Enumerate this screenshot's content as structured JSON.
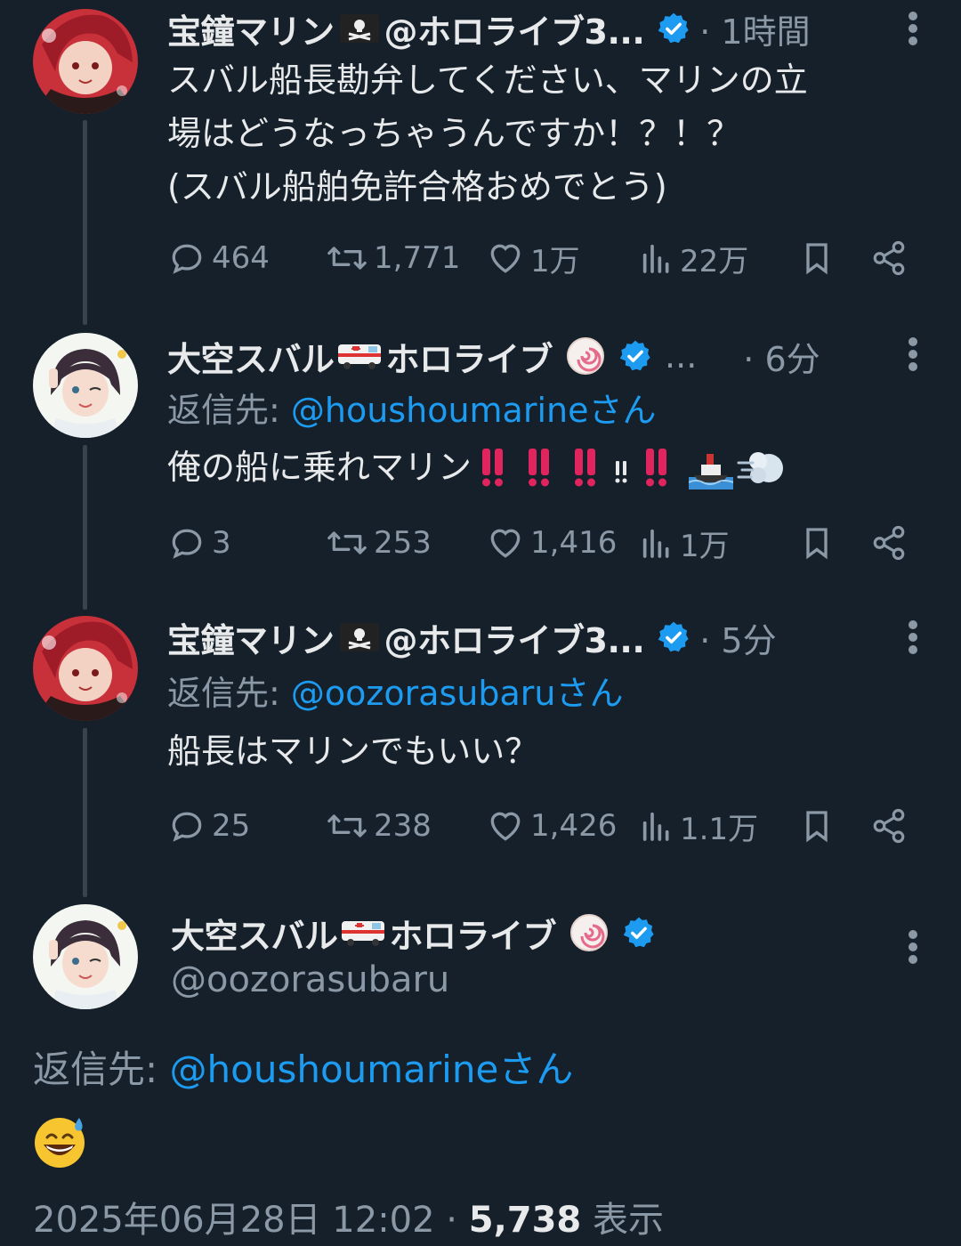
{
  "tweets": [
    {
      "name": "宝鐘マリン",
      "name_suffix": "@ホロライブ3...",
      "name_emoji": "pirate-flag-icon",
      "time": "· 1時間",
      "reply_to_label": "",
      "reply_to_handle": "",
      "text_lines": [
        "スバル船長勘弁してください、マリンの立",
        "場はどうなっちゃうんですか！？！？",
        "(スバル船舶免許合格おめでとう)"
      ],
      "replies": "464",
      "retweets": "1,771",
      "likes": "1万",
      "views": "22万"
    },
    {
      "name": "大空スバル",
      "name_suffix": "ホロライブ",
      "name_emoji": "ambulance-icon",
      "extra": "...",
      "time": "· 6分",
      "reply_to_label": "返信先: ",
      "reply_to_handle": "@houshoumarineさん",
      "text_main": "俺の船に乗れマリン",
      "replies": "3",
      "retweets": "253",
      "likes": "1,416",
      "views": "1万"
    },
    {
      "name": "宝鐘マリン",
      "name_suffix": "@ホロライブ3...",
      "name_emoji": "pirate-flag-icon",
      "time": "· 5分",
      "reply_to_label": "返信先: ",
      "reply_to_handle": "@oozorasubaruさん",
      "text_main": "船長はマリンでもいい？",
      "replies": "25",
      "retweets": "238",
      "likes": "1,426",
      "views": "1.1万"
    }
  ],
  "main": {
    "name": "大空スバル",
    "name_suffix": "ホロライブ",
    "handle": "@oozorasubaru",
    "reply_to_label": "返信先: ",
    "reply_to_handle": "@houshoumarineさん",
    "emoji": "grinning-sweat-icon",
    "timestamp": "2025年06月28日 12:02 · ",
    "views": "5,738",
    "views_label": " 表示"
  },
  "colors": {
    "background": "#15202b",
    "accent": "#1d9bf0",
    "muted": "#8b98a5",
    "text": "#e7e9ea"
  }
}
